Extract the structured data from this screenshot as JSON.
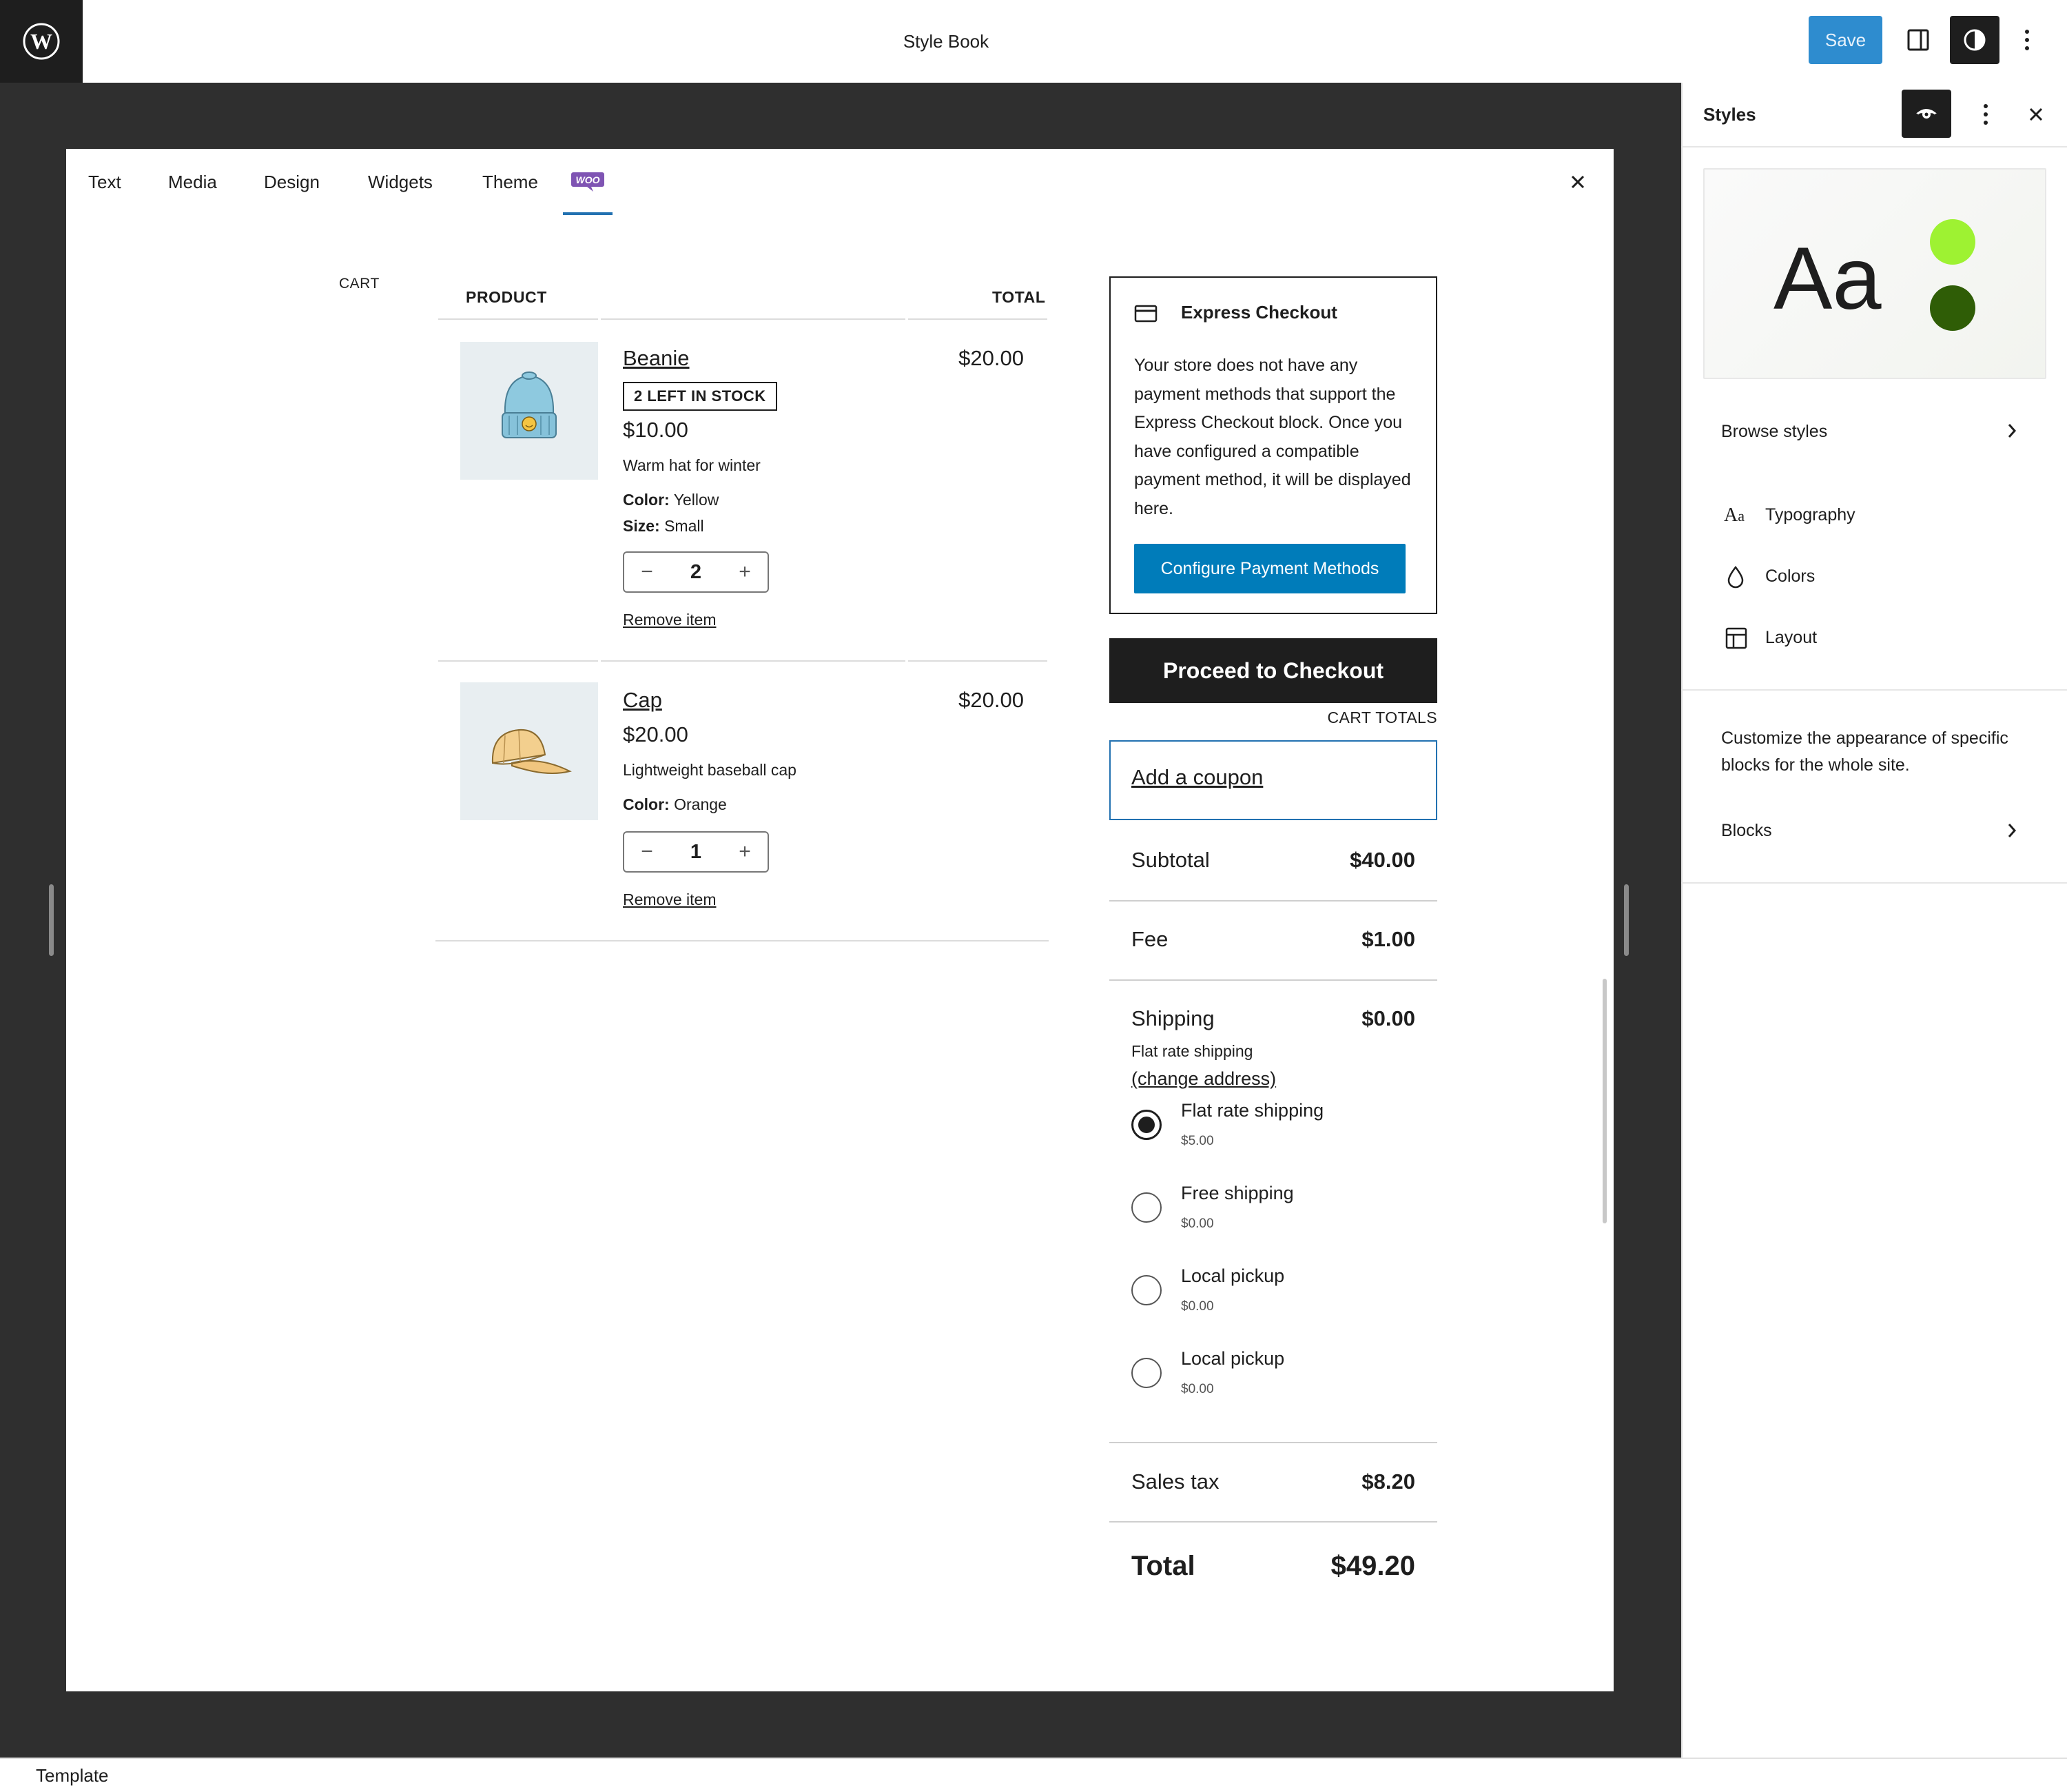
{
  "header": {
    "title": "Style Book",
    "save_label": "Save"
  },
  "tabs": [
    {
      "label": "Text"
    },
    {
      "label": "Media"
    },
    {
      "label": "Design"
    },
    {
      "label": "Widgets"
    },
    {
      "label": "Theme"
    },
    {
      "label": "WOO",
      "icon": "woo-icon",
      "active": true
    }
  ],
  "cart": {
    "block_label": "CART",
    "col_product": "PRODUCT",
    "col_total": "TOTAL",
    "items": [
      {
        "name": "Beanie",
        "badge": "2 LEFT IN STOCK",
        "price": "$10.00",
        "description": "Warm hat for winter",
        "attributes": [
          {
            "key": "Color:",
            "value": "Yellow"
          },
          {
            "key": "Size:",
            "value": "Small"
          }
        ],
        "quantity": "2",
        "remove_label": "Remove item",
        "line_total": "$20.00",
        "icon": "beanie-image"
      },
      {
        "name": "Cap",
        "price": "$20.00",
        "description": "Lightweight baseball cap",
        "attributes": [
          {
            "key": "Color:",
            "value": "Orange"
          }
        ],
        "quantity": "1",
        "remove_label": "Remove item",
        "line_total": "$20.00",
        "icon": "cap-image"
      }
    ]
  },
  "express": {
    "title": "Express Checkout",
    "body": "Your store does not have any payment methods that support the Express Checkout block. Once you have configured a compatible payment method, it will be displayed here.",
    "button": "Configure Payment Methods"
  },
  "checkout": {
    "button": "Proceed to Checkout",
    "totals_label": "CART TOTALS",
    "coupon": "Add a coupon",
    "subtotal_label": "Subtotal",
    "subtotal": "$40.00",
    "fee_label": "Fee",
    "fee": "$1.00",
    "shipping_label": "Shipping",
    "shipping": "$0.00",
    "shipping_method": "Flat rate shipping",
    "change_address": "(change address)",
    "options": [
      {
        "label": "Flat rate shipping",
        "price": "$5.00",
        "selected": true
      },
      {
        "label": "Free shipping",
        "price": "$0.00",
        "selected": false
      },
      {
        "label": "Local pickup",
        "price": "$0.00",
        "selected": false
      },
      {
        "label": "Local pickup",
        "price": "$0.00",
        "selected": false
      }
    ],
    "tax_label": "Sales tax",
    "tax": "$8.20",
    "total_label": "Total",
    "total": "$49.20"
  },
  "sidebar": {
    "title": "Styles",
    "preview_text": "Aa",
    "browse_styles": "Browse styles",
    "items": [
      {
        "label": "Typography",
        "icon": "typography-icon"
      },
      {
        "label": "Colors",
        "icon": "colors-icon"
      },
      {
        "label": "Layout",
        "icon": "layout-icon"
      }
    ],
    "blocks_description": "Customize the appearance of specific blocks for the whole site.",
    "blocks": "Blocks",
    "preview_colors": {
      "primary": "#9ef232",
      "secondary": "#2f5d06"
    }
  },
  "footer": {
    "label": "Template"
  },
  "colors": {
    "accent": "#007cba",
    "dark": "#1e1e1e",
    "canvas": "#2f2f2f"
  }
}
